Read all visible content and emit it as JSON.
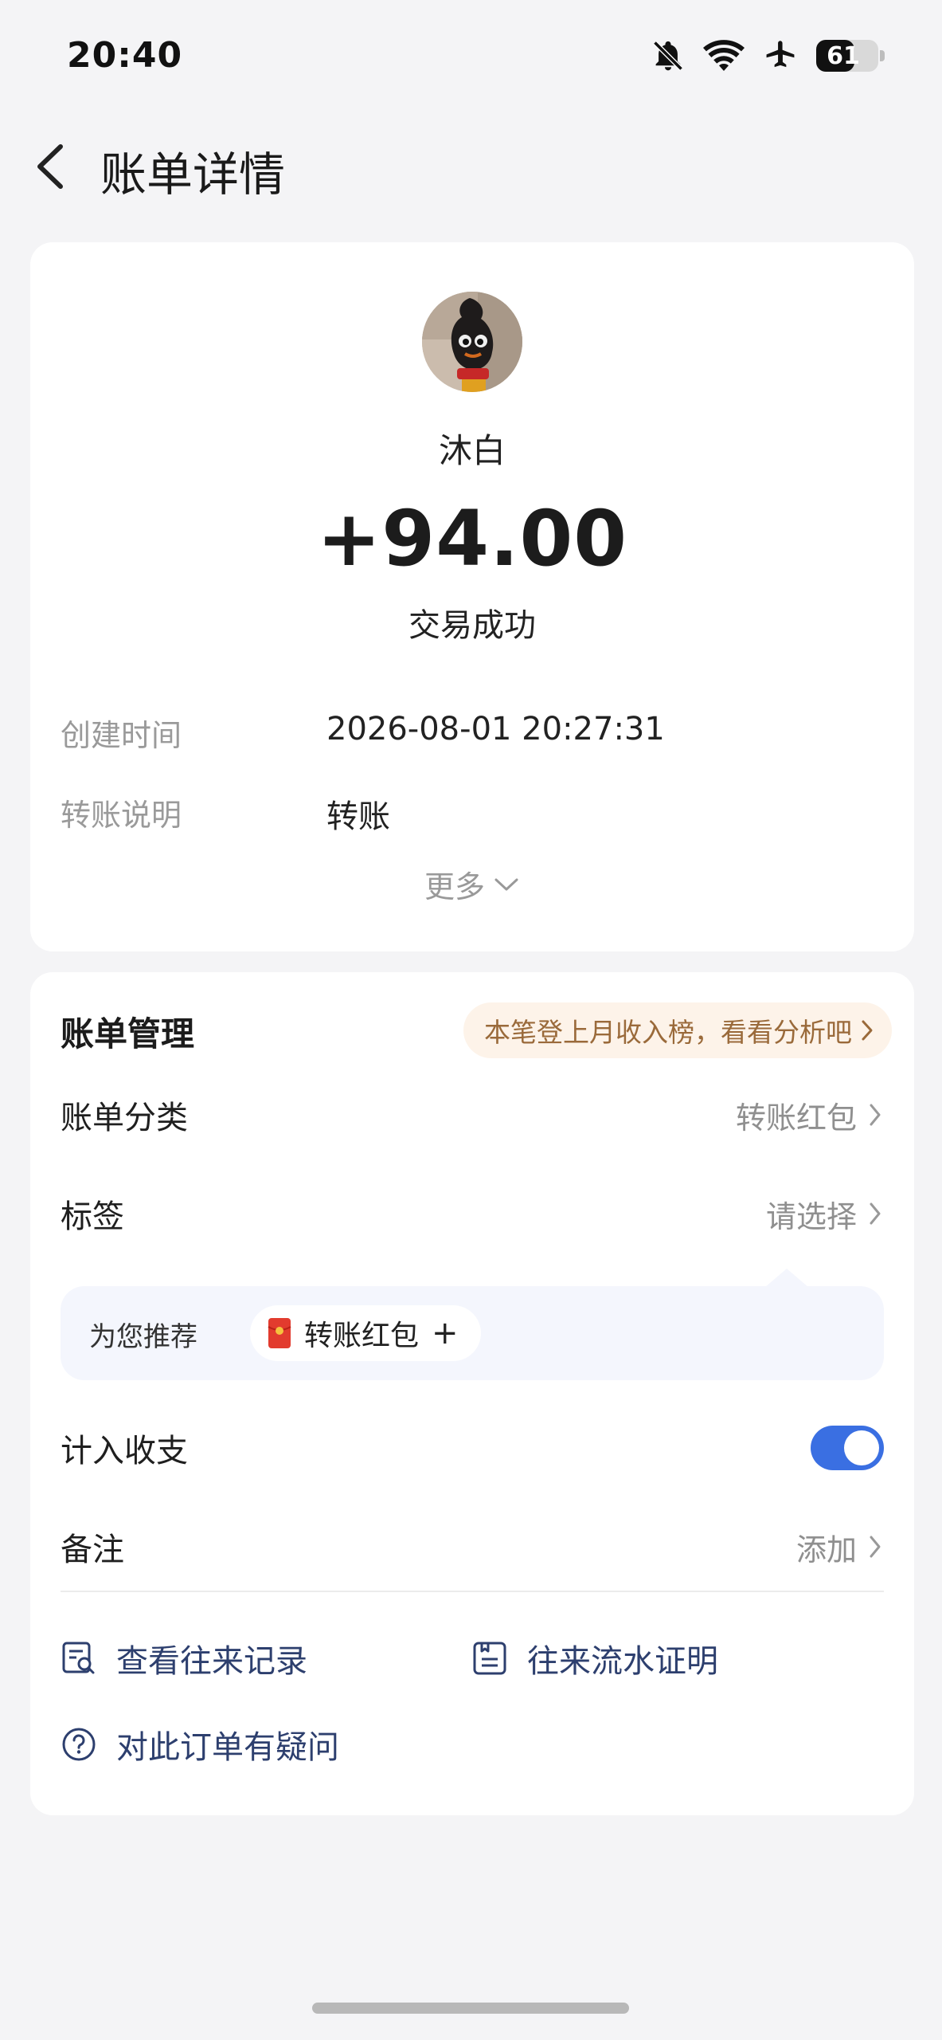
{
  "status_bar": {
    "time": "20:40",
    "icons": [
      "bell-off-icon",
      "wifi-icon",
      "airplane-icon"
    ],
    "battery": {
      "level": 61,
      "label": "61"
    }
  },
  "header": {
    "title": "账单详情"
  },
  "transaction": {
    "payer_name": "沐白",
    "amount": "+94.00",
    "status": "交易成功",
    "details": [
      {
        "label": "创建时间",
        "value": "2026-08-01 20:27:31"
      },
      {
        "label": "转账说明",
        "value": "转账"
      }
    ],
    "more_label": "更多"
  },
  "management": {
    "title": "账单管理",
    "promo": "本笔登上月收入榜，看看分析吧",
    "category": {
      "label": "账单分类",
      "value": "转账红包"
    },
    "tags": {
      "label": "标签",
      "value": "请选择"
    },
    "recommend": {
      "label": "为您推荐",
      "chip": "转账红包",
      "chip_action": "+"
    },
    "include_in_stats": {
      "label": "计入收支",
      "enabled": true
    },
    "remark": {
      "label": "备注",
      "value": "添加"
    },
    "links": {
      "history": "查看往来记录",
      "proof": "往来流水证明",
      "question": "对此订单有疑问"
    }
  },
  "colors": {
    "accent": "#3a6fe2",
    "link": "#2d3f6e",
    "promo_bg": "#fdf3e9",
    "promo_text": "#9a6a3a",
    "red_packet": "#e23b2e"
  }
}
